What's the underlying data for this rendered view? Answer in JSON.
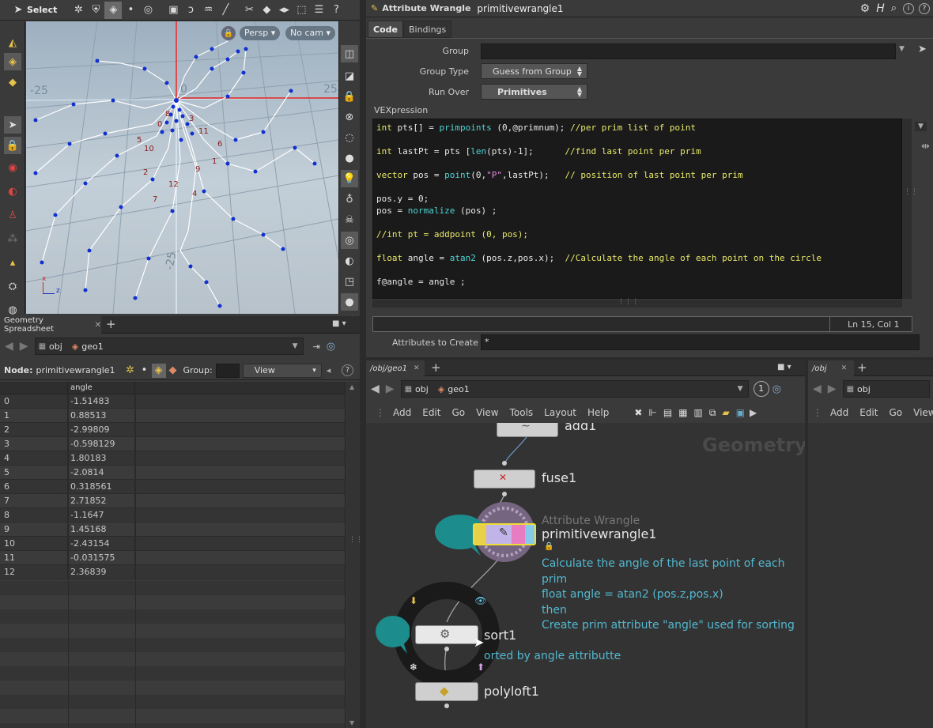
{
  "viewport": {
    "select_label": "Select",
    "persp_label": "Persp ▾",
    "cam_label": "No cam ▾",
    "axis_labels": {
      "neg_x": "-25",
      "pos_x": "25",
      "zero": "0",
      "neg_z": "-25"
    },
    "point_numbers": [
      "8",
      "3",
      "0",
      "11",
      "6",
      "5",
      "10",
      "1",
      "9",
      "2",
      "12",
      "4",
      "7"
    ],
    "gizmo_x": "x",
    "gizmo_z": "z"
  },
  "spreadsheet": {
    "tab_label": "Geometry Spreadsheet",
    "path": {
      "obj": "obj",
      "geo": "geo1"
    },
    "node_label": "Node:",
    "node_name": "primitivewrangle1",
    "group_label": "Group:",
    "view_label": "View",
    "column_header": "angle",
    "rows": [
      {
        "idx": "0",
        "val": "-1.51483"
      },
      {
        "idx": "1",
        "val": "0.88513"
      },
      {
        "idx": "2",
        "val": "-2.99809"
      },
      {
        "idx": "3",
        "val": "-0.598129"
      },
      {
        "idx": "4",
        "val": "1.80183"
      },
      {
        "idx": "5",
        "val": "-2.0814"
      },
      {
        "idx": "6",
        "val": "0.318561"
      },
      {
        "idx": "7",
        "val": "2.71852"
      },
      {
        "idx": "8",
        "val": "-1.1647"
      },
      {
        "idx": "9",
        "val": "1.45168"
      },
      {
        "idx": "10",
        "val": "-2.43154"
      },
      {
        "idx": "11",
        "val": "-0.031575"
      },
      {
        "idx": "12",
        "val": "2.36839"
      }
    ]
  },
  "wrangle": {
    "type_label": "Attribute Wrangle",
    "node_name": "primitivewrangle1",
    "tabs": [
      "Code",
      "Bindings"
    ],
    "group_label": "Group",
    "group_type_label": "Group Type",
    "group_type_value": "Guess from Group",
    "run_over_label": "Run Over",
    "run_over_value": "Primitives",
    "vex_label": "VEXpression",
    "status": "Ln 15, Col 1",
    "attrs_label": "Attributes to Create",
    "attrs_value": "*",
    "code": {
      "l1a": "int",
      "l1b": " pts[] = ",
      "l1c": "primpoints",
      "l1d": " (0,@primnum); ",
      "l1e": "//per prim list of point",
      "l2a": "int",
      "l2b": " lastPt = pts [",
      "l2c": "len",
      "l2d": "(pts)-1];      ",
      "l2e": "//find last point per prim",
      "l3a": "vector",
      "l3b": " pos = ",
      "l3c": "point",
      "l3d": "(0,",
      "l3s": "\"P\"",
      "l3f": ",lastPt);   ",
      "l3e": "// position of last point per prim",
      "l4": "pos.y = 0;",
      "l5a": "pos = ",
      "l5b": "normalize",
      "l5c": " (pos) ;",
      "l6": "//int pt = addpoint (0, pos);",
      "l7a": "float",
      "l7b": " angle = ",
      "l7c": "atan2",
      "l7d": " (pos.z,pos.x);  ",
      "l7e": "//Calculate the angle of each point on the circle",
      "l8": "f@angle = angle ;"
    }
  },
  "network": {
    "tab_label": "/obj/geo1",
    "path": {
      "obj": "obj",
      "geo": "geo1"
    },
    "badge": "1",
    "menu": [
      "Add",
      "Edit",
      "Go",
      "View",
      "Tools",
      "Layout",
      "Help"
    ],
    "context_label": "Geometry",
    "nodes": {
      "add": "add1",
      "fuse": "fuse1",
      "wrangle_type": "Attribute Wrangle",
      "wrangle": "primitivewrangle1",
      "sort": "sort1",
      "polyloft": "polyloft1"
    },
    "note_wrangle": [
      "Calculate the angle of the last point of each prim",
      "float angle = atan2 (pos.z,pos.x)",
      "then",
      "Create prim attribute \"angle\" used for sorting"
    ],
    "note_sort": "orted by angle attributte"
  },
  "network2": {
    "tab_label": "/obj",
    "path": "obj",
    "menu": [
      "Add",
      "Edit",
      "Go",
      "View"
    ]
  }
}
